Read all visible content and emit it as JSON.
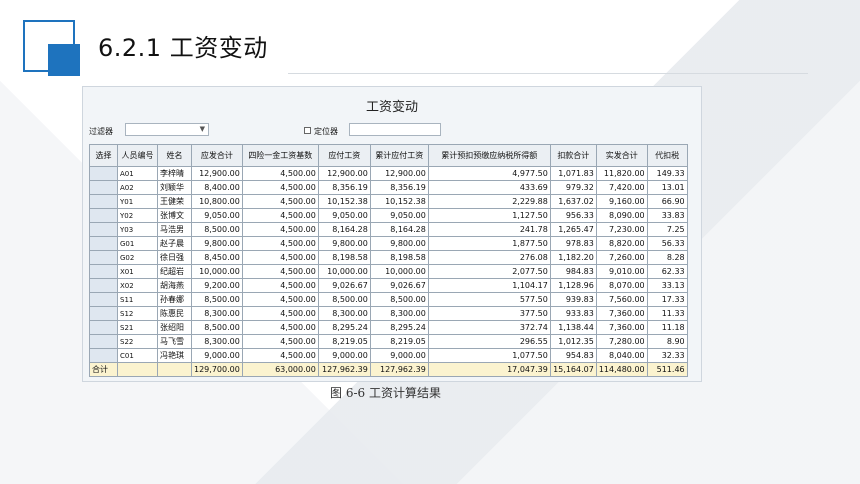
{
  "slide": {
    "title": "6.2.1  工资变动",
    "caption": "图 6-6  工资计算结果"
  },
  "window": {
    "title": "工资变动",
    "filter_label": "过滤器",
    "filter_value": "",
    "locator_label": "定位器",
    "locator_value": ""
  },
  "table": {
    "headers": [
      "选择",
      "人员编号",
      "姓名",
      "应发合计",
      "四险一金工资基数",
      "应付工资",
      "累计应付工资",
      "累计预扣预缴应纳税所得额",
      "扣款合计",
      "实发合计",
      "代扣税"
    ],
    "rows": [
      [
        "",
        "A01",
        "李梓晴",
        "12,900.00",
        "4,500.00",
        "12,900.00",
        "12,900.00",
        "4,977.50",
        "1,071.83",
        "11,820.00",
        "149.33"
      ],
      [
        "",
        "A02",
        "刘颖华",
        "8,400.00",
        "4,500.00",
        "8,356.19",
        "8,356.19",
        "433.69",
        "979.32",
        "7,420.00",
        "13.01"
      ],
      [
        "",
        "Y01",
        "王健荣",
        "10,800.00",
        "4,500.00",
        "10,152.38",
        "10,152.38",
        "2,229.88",
        "1,637.02",
        "9,160.00",
        "66.90"
      ],
      [
        "",
        "Y02",
        "张博文",
        "9,050.00",
        "4,500.00",
        "9,050.00",
        "9,050.00",
        "1,127.50",
        "956.33",
        "8,090.00",
        "33.83"
      ],
      [
        "",
        "Y03",
        "马浩男",
        "8,500.00",
        "4,500.00",
        "8,164.28",
        "8,164.28",
        "241.78",
        "1,265.47",
        "7,230.00",
        "7.25"
      ],
      [
        "",
        "G01",
        "赵子晨",
        "9,800.00",
        "4,500.00",
        "9,800.00",
        "9,800.00",
        "1,877.50",
        "978.83",
        "8,820.00",
        "56.33"
      ],
      [
        "",
        "G02",
        "徐日强",
        "8,450.00",
        "4,500.00",
        "8,198.58",
        "8,198.58",
        "276.08",
        "1,182.20",
        "7,260.00",
        "8.28"
      ],
      [
        "",
        "X01",
        "纪超岩",
        "10,000.00",
        "4,500.00",
        "10,000.00",
        "10,000.00",
        "2,077.50",
        "984.83",
        "9,010.00",
        "62.33"
      ],
      [
        "",
        "X02",
        "胡海燕",
        "9,200.00",
        "4,500.00",
        "9,026.67",
        "9,026.67",
        "1,104.17",
        "1,128.96",
        "8,070.00",
        "33.13"
      ],
      [
        "",
        "S11",
        "孙春娜",
        "8,500.00",
        "4,500.00",
        "8,500.00",
        "8,500.00",
        "577.50",
        "939.83",
        "7,560.00",
        "17.33"
      ],
      [
        "",
        "S12",
        "陈惠民",
        "8,300.00",
        "4,500.00",
        "8,300.00",
        "8,300.00",
        "377.50",
        "933.83",
        "7,360.00",
        "11.33"
      ],
      [
        "",
        "S21",
        "张绍阳",
        "8,500.00",
        "4,500.00",
        "8,295.24",
        "8,295.24",
        "372.74",
        "1,138.44",
        "7,360.00",
        "11.18"
      ],
      [
        "",
        "S22",
        "马飞雪",
        "8,300.00",
        "4,500.00",
        "8,219.05",
        "8,219.05",
        "296.55",
        "1,012.35",
        "7,280.00",
        "8.90"
      ],
      [
        "",
        "C01",
        "冯艳琪",
        "9,000.00",
        "4,500.00",
        "9,000.00",
        "9,000.00",
        "1,077.50",
        "954.83",
        "8,040.00",
        "32.33"
      ]
    ],
    "total": [
      "合计",
      "",
      "",
      "129,700.00",
      "63,000.00",
      "127,962.39",
      "127,962.39",
      "17,047.39",
      "15,164.07",
      "114,480.00",
      "511.46"
    ]
  }
}
